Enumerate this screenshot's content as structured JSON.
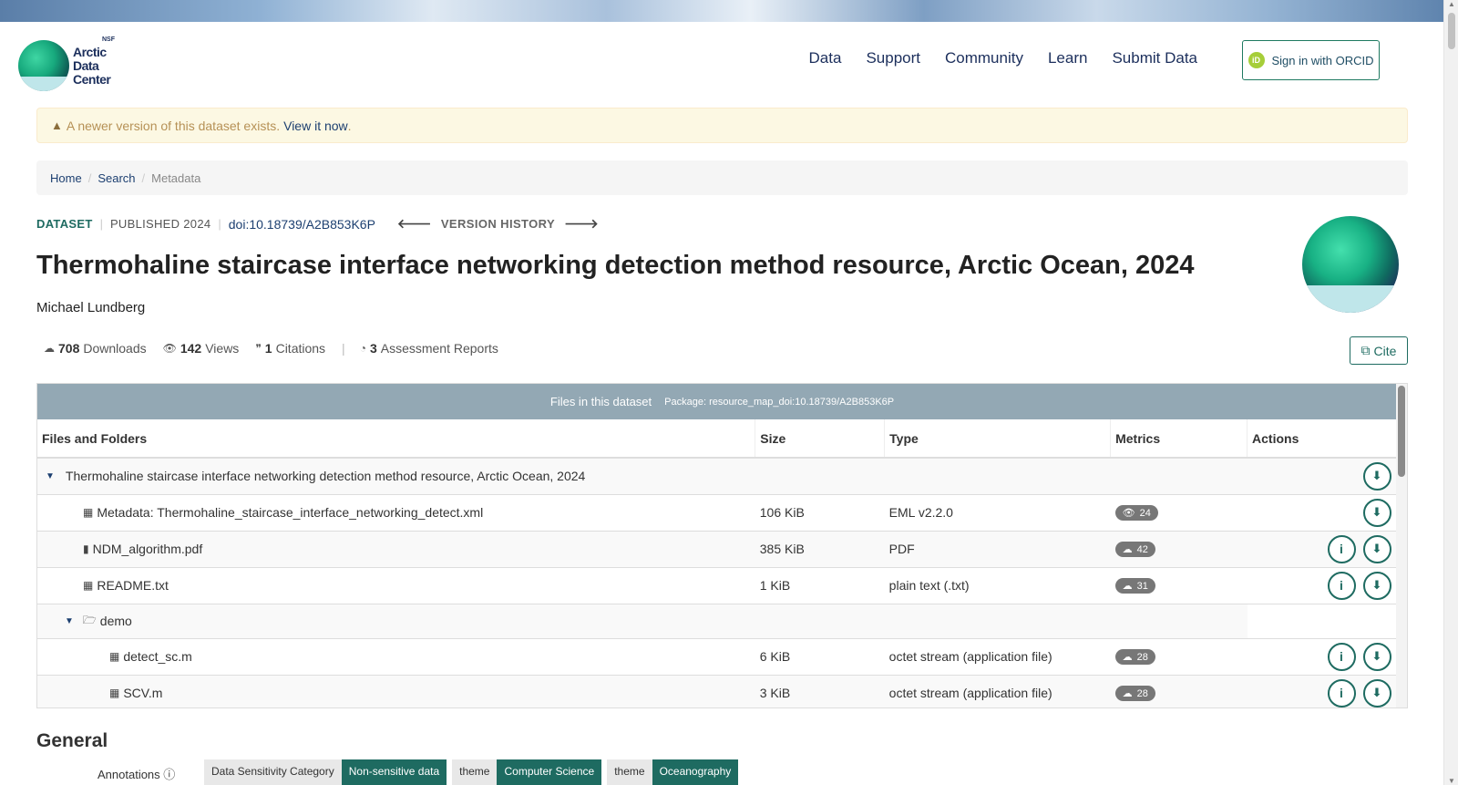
{
  "nav": {
    "items": [
      "Data",
      "Support",
      "Community",
      "Learn",
      "Submit Data"
    ],
    "orcid_label": "Sign in with ORCID",
    "orcid_icon": "iD"
  },
  "logo": {
    "nsf": "NSF",
    "line1": "Arctic",
    "line2": "Data",
    "line3": "Center"
  },
  "alert": {
    "text": "A newer version of this dataset exists.",
    "link": "View it now",
    "suffix": "."
  },
  "breadcrumb": {
    "items": [
      "Home",
      "Search",
      "Metadata"
    ]
  },
  "dataset": {
    "label": "DATASET",
    "published": "PUBLISHED 2024",
    "doi": "doi:10.18739/A2B853K6P",
    "version_history": "VERSION HISTORY",
    "title": "Thermohaline staircase interface networking detection method resource, Arctic Ocean, 2024",
    "author": "Michael Lundberg"
  },
  "metrics": {
    "downloads_count": "708",
    "downloads_label": "Downloads",
    "views_count": "142",
    "views_label": "Views",
    "citations_count": "1",
    "citations_label": "Citations",
    "assessment_count": "3",
    "assessment_label": "Assessment Reports",
    "cite_label": "Cite"
  },
  "files": {
    "header_title": "Files in this dataset",
    "package": "Package: resource_map_doi:10.18739/A2B853K6P",
    "columns": [
      "Files and Folders",
      "Size",
      "Type",
      "Metrics",
      "Actions"
    ],
    "rows": [
      {
        "name": "Thermohaline staircase interface networking detection method resource, Arctic Ocean, 2024",
        "size": "",
        "type": "",
        "metric": ""
      },
      {
        "name": "Metadata: Thermohaline_staircase_interface_networking_detect.xml",
        "size": "106 KiB",
        "type": "EML v2.2.0",
        "metric": "24"
      },
      {
        "name": "NDM_algorithm.pdf",
        "size": "385 KiB",
        "type": "PDF",
        "metric": "42"
      },
      {
        "name": "README.txt",
        "size": "1 KiB",
        "type": "plain text (.txt)",
        "metric": "31"
      },
      {
        "name": "demo",
        "size": "",
        "type": "",
        "metric": ""
      },
      {
        "name": "detect_sc.m",
        "size": "6 KiB",
        "type": "octet stream (application file)",
        "metric": "28"
      },
      {
        "name": "SCV.m",
        "size": "3 KiB",
        "type": "octet stream (application file)",
        "metric": "28"
      }
    ]
  },
  "general": {
    "heading": "General",
    "annotations_label": "Annotations",
    "tags": [
      {
        "key": "Data Sensitivity Category",
        "value": "Non-sensitive data"
      },
      {
        "key": "theme",
        "value": "Computer Science"
      },
      {
        "key": "theme",
        "value": "Oceanography"
      }
    ]
  },
  "colors": {
    "accent": "#1e6b61",
    "link": "#1c3f70",
    "alert_bg": "#fcf8e3",
    "table_header": "#93a8b4"
  }
}
